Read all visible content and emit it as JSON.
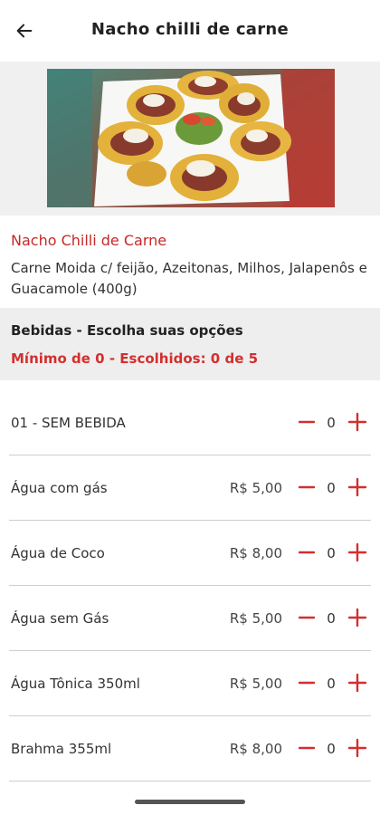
{
  "header": {
    "title": "Nacho chilli de carne",
    "back_icon": "arrow-left-icon"
  },
  "product": {
    "image_icon": "nachos-photo",
    "name": "Nacho Chilli de Carne",
    "description": "Carne Moida c/ feijão, Azeitonas, Milhos, Jalapenôs e Guacamole (400g)"
  },
  "group": {
    "title": "Bebidas - Escolha suas opções",
    "rule": "Mínimo de 0 - Escolhidos: 0 de 5"
  },
  "options": [
    {
      "name": "01 - SEM BEBIDA",
      "price": "",
      "qty": "0"
    },
    {
      "name": "Água com gás",
      "price": "R$ 5,00",
      "qty": "0"
    },
    {
      "name": "Água de Coco",
      "price": "R$ 8,00",
      "qty": "0"
    },
    {
      "name": "Água sem Gás",
      "price": "R$ 5,00",
      "qty": "0"
    },
    {
      "name": "Água Tônica 350ml",
      "price": "R$ 5,00",
      "qty": "0"
    },
    {
      "name": "Brahma 355ml",
      "price": "R$ 8,00",
      "qty": "0"
    }
  ],
  "colors": {
    "accent": "#d32f2f",
    "product_name": "#c62828",
    "group_bg": "#eeeeee"
  }
}
